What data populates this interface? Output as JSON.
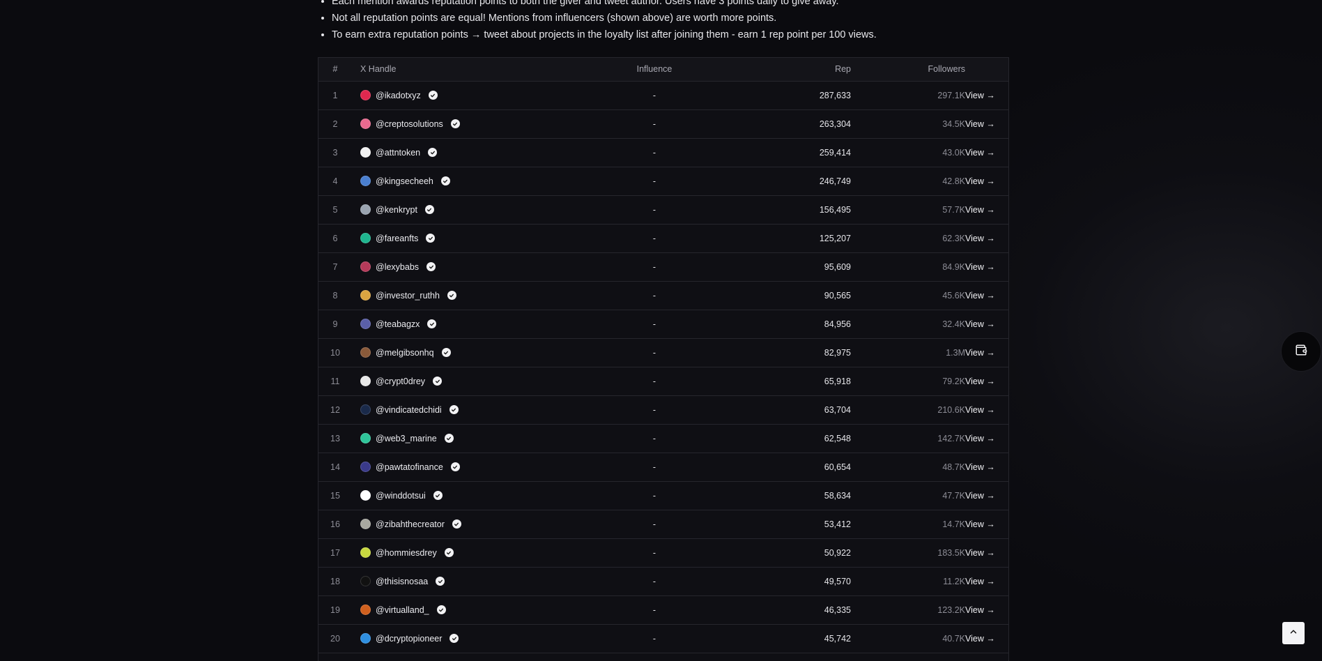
{
  "rules": [
    "Each mention awards reputation points to both the giver and tweet author. Users have 3 points daily to give away.",
    "Not all reputation points are equal! Mentions from influencers (shown above) are worth more points.",
    "To earn extra reputation points → tweet about projects in the loyalty list after joining them - earn 1 rep point per 100 views."
  ],
  "table": {
    "headers": {
      "rank": "#",
      "handle": "X Handle",
      "influence": "Influence",
      "rep": "Rep",
      "followers": "Followers"
    },
    "rows": [
      {
        "rank": "1",
        "handle": "@ikadotxyz",
        "influence": "-",
        "rep": "287,633",
        "followers": "297.1K",
        "view": "View →",
        "avatar_color": "#e0284f"
      },
      {
        "rank": "2",
        "handle": "@creptosolutions",
        "influence": "-",
        "rep": "263,304",
        "followers": "34.5K",
        "view": "View →",
        "avatar_color": "#e86a8f"
      },
      {
        "rank": "3",
        "handle": "@attntoken",
        "influence": "-",
        "rep": "259,414",
        "followers": "43.0K",
        "view": "View →",
        "avatar_color": "#f2f2f2"
      },
      {
        "rank": "4",
        "handle": "@kingsecheeh",
        "influence": "-",
        "rep": "246,749",
        "followers": "42.8K",
        "view": "View →",
        "avatar_color": "#4a7fd0"
      },
      {
        "rank": "5",
        "handle": "@kenkrypt",
        "influence": "-",
        "rep": "156,495",
        "followers": "57.7K",
        "view": "View →",
        "avatar_color": "#9aa4b0"
      },
      {
        "rank": "6",
        "handle": "@fareanfts",
        "influence": "-",
        "rep": "125,207",
        "followers": "62.3K",
        "view": "View →",
        "avatar_color": "#1fb58f"
      },
      {
        "rank": "7",
        "handle": "@lexybabs",
        "influence": "-",
        "rep": "95,609",
        "followers": "84.9K",
        "view": "View →",
        "avatar_color": "#b53a5a"
      },
      {
        "rank": "8",
        "handle": "@investor_ruthh",
        "influence": "-",
        "rep": "90,565",
        "followers": "45.6K",
        "view": "View →",
        "avatar_color": "#d9a441"
      },
      {
        "rank": "9",
        "handle": "@teabagzx",
        "influence": "-",
        "rep": "84,956",
        "followers": "32.4K",
        "view": "View →",
        "avatar_color": "#5a5fa8"
      },
      {
        "rank": "10",
        "handle": "@melgibsonhq",
        "influence": "-",
        "rep": "82,975",
        "followers": "1.3M",
        "view": "View →",
        "avatar_color": "#8a5a3a"
      },
      {
        "rank": "11",
        "handle": "@crypt0drey",
        "influence": "-",
        "rep": "65,918",
        "followers": "79.2K",
        "view": "View →",
        "avatar_color": "#e8e8e8"
      },
      {
        "rank": "12",
        "handle": "@vindicatedchidi",
        "influence": "-",
        "rep": "63,704",
        "followers": "210.6K",
        "view": "View →",
        "avatar_color": "#1a2a4a"
      },
      {
        "rank": "13",
        "handle": "@web3_marine",
        "influence": "-",
        "rep": "62,548",
        "followers": "142.7K",
        "view": "View →",
        "avatar_color": "#2fc59a"
      },
      {
        "rank": "14",
        "handle": "@pawtatofinance",
        "influence": "-",
        "rep": "60,654",
        "followers": "48.7K",
        "view": "View →",
        "avatar_color": "#3a3a8a"
      },
      {
        "rank": "15",
        "handle": "@winddotsui",
        "influence": "-",
        "rep": "58,634",
        "followers": "47.7K",
        "view": "View →",
        "avatar_color": "#ffffff"
      },
      {
        "rank": "16",
        "handle": "@zibahthecreator",
        "influence": "-",
        "rep": "53,412",
        "followers": "14.7K",
        "view": "View →",
        "avatar_color": "#a8a8a0"
      },
      {
        "rank": "17",
        "handle": "@hommiesdrey",
        "influence": "-",
        "rep": "50,922",
        "followers": "183.5K",
        "view": "View →",
        "avatar_color": "#c8d840"
      },
      {
        "rank": "18",
        "handle": "@thisisnosaa",
        "influence": "-",
        "rep": "49,570",
        "followers": "11.2K",
        "view": "View →",
        "avatar_color": "#111111"
      },
      {
        "rank": "19",
        "handle": "@virtualland_",
        "influence": "-",
        "rep": "46,335",
        "followers": "123.2K",
        "view": "View →",
        "avatar_color": "#d0601e"
      },
      {
        "rank": "20",
        "handle": "@dcryptopioneer",
        "influence": "-",
        "rep": "45,742",
        "followers": "40.7K",
        "view": "View →",
        "avatar_color": "#2f8fe0"
      },
      {
        "rank": "",
        "handle": "",
        "influence": "",
        "rep": "",
        "followers": "",
        "view": "",
        "avatar_color": "#0f0f14"
      }
    ]
  },
  "icons": {
    "verified": "verified-check-icon",
    "wallet": "wallet-icon",
    "scroll_top": "chevron-up-icon"
  }
}
